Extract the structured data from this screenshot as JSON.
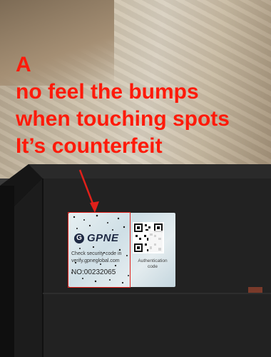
{
  "caption": {
    "line1": "A",
    "line2": "no feel the bumps",
    "line3": "when touching spots",
    "line4": "It’s counterfeit"
  },
  "sticker": {
    "brand": "GPNE",
    "logo_letter": "G",
    "check_line1": "Check security code in",
    "check_line2": "verify.gpneglobal.com",
    "serial": "NO:00232065",
    "auth_label": "Authentication code"
  },
  "colors": {
    "annotation": "#ff1a0a",
    "device": "#1e1e1e"
  }
}
